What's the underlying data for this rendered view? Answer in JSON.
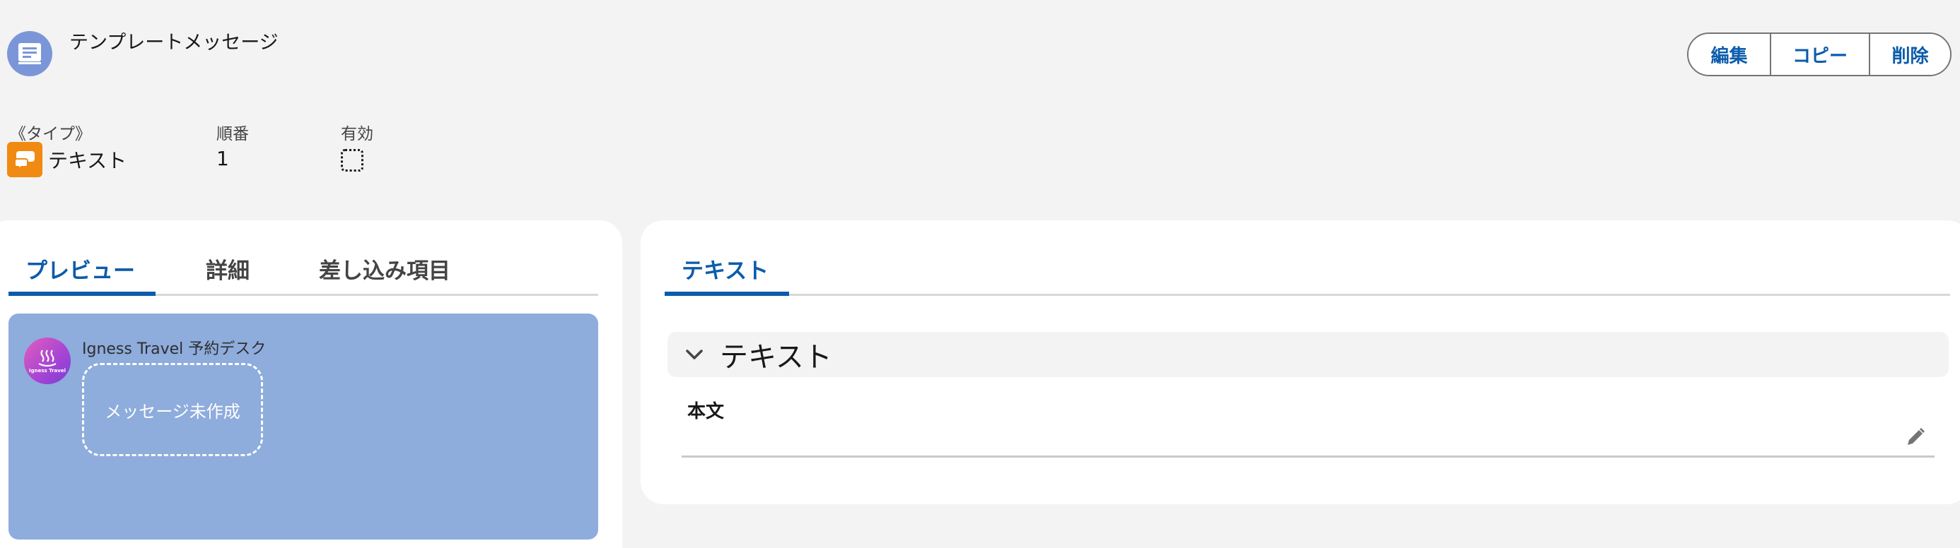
{
  "header": {
    "title": "テンプレートメッセージ",
    "icon": "template-message-icon",
    "actions": {
      "edit": "編集",
      "copy": "コピー",
      "delete": "削除"
    }
  },
  "highlights": {
    "type_label": "《タイプ》",
    "type_value": "テキスト",
    "type_icon": "chat-bubbles-icon",
    "order_label": "順番",
    "order_value": "1",
    "active_label": "有効",
    "active_checked": false
  },
  "left_tabs": [
    {
      "label": "プレビュー",
      "active": true
    },
    {
      "label": "詳細",
      "active": false
    },
    {
      "label": "差し込み項目",
      "active": false
    }
  ],
  "preview": {
    "sender_name": "Igness Travel 予約デスク",
    "avatar_text": "Igness Travel",
    "bubble_text": "メッセージ未作成"
  },
  "right_tabs": [
    {
      "label": "テキスト",
      "active": true
    }
  ],
  "section": {
    "title": "テキスト",
    "field_label": "本文",
    "field_value": ""
  },
  "colors": {
    "accent": "#0b5cab",
    "preview_bg": "#8eacdc",
    "type_icon_bg": "#f08a12",
    "object_icon_bg": "#7b96d8"
  }
}
